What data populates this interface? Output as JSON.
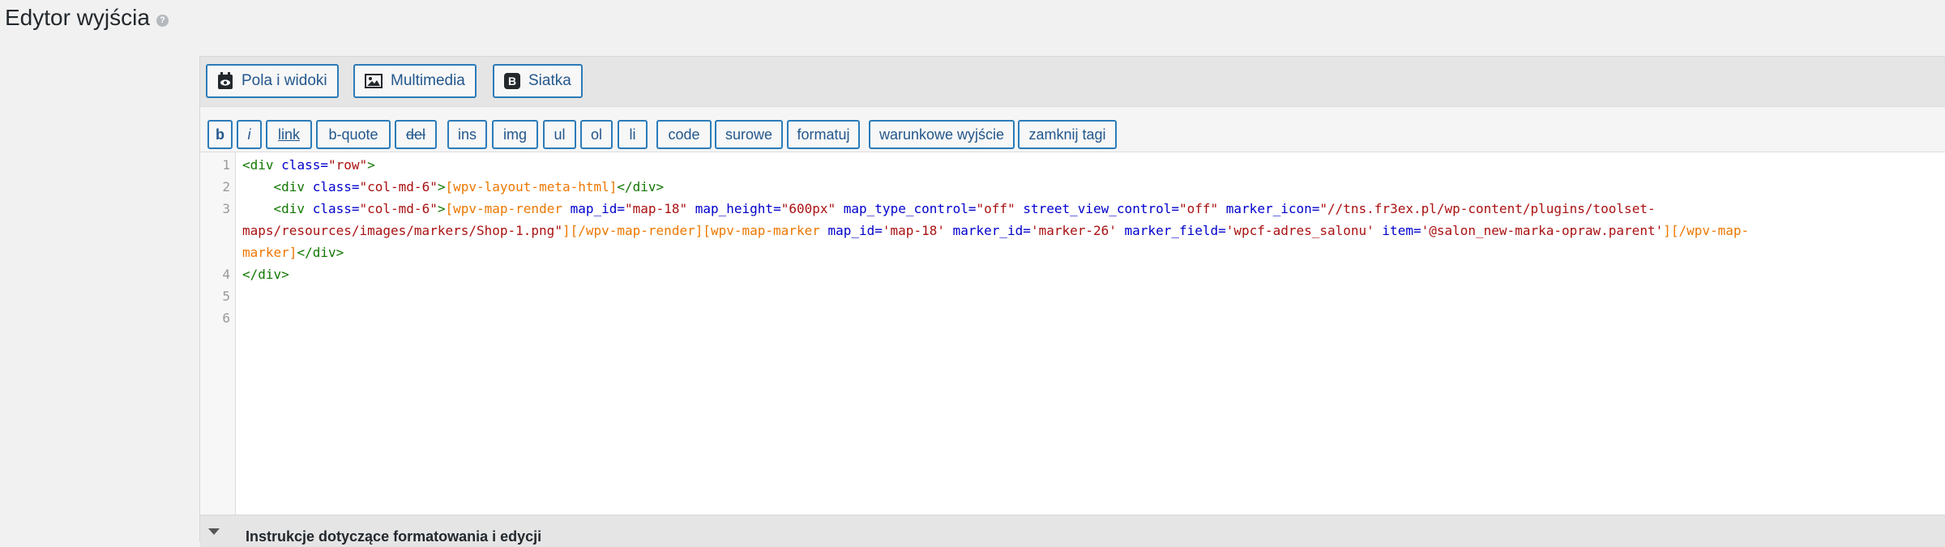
{
  "page": {
    "title": "Edytor wyjścia",
    "help_icon": "question-circle-icon"
  },
  "toolbar": {
    "fields_views_label": "Pola i widoki",
    "multimedia_label": "Multimedia",
    "grid_label": "Siatka"
  },
  "quicktags": [
    {
      "label": "b"
    },
    {
      "label": "i"
    },
    {
      "label": "link"
    },
    {
      "label": "b-quote"
    },
    {
      "label": "del"
    },
    {
      "label": "ins"
    },
    {
      "label": "img"
    },
    {
      "label": "ul"
    },
    {
      "label": "ol"
    },
    {
      "label": "li"
    },
    {
      "label": "code"
    },
    {
      "label": "surowe"
    },
    {
      "label": "formatuj"
    },
    {
      "label": "warunkowe wyjście"
    },
    {
      "label": "zamknij tagi"
    }
  ],
  "editor": {
    "line_numbers": [
      "1",
      "2",
      "3",
      "4",
      "5",
      "6"
    ],
    "l1_tag": "<div ",
    "l1_attr": "class=",
    "l1_str": "\"row\"",
    "l1_end": ">",
    "l2_indent": "    ",
    "l2_tag": "<div ",
    "l2_attr": "class=",
    "l2_str": "\"col-md-6\"",
    "l2_gt": ">",
    "l2_sc": "[wpv-layout-meta-html]",
    "l2_close": "</div>",
    "l3a_indent": "    ",
    "l3a_tag": "<div ",
    "l3a_attr": "class=",
    "l3a_str": "\"col-md-6\"",
    "l3a_gt": ">",
    "l3a_sc": "[wpv-map-render ",
    "l3a_a1": "map_id=",
    "l3a_s1": "\"map-18\" ",
    "l3a_a2": "map_height=",
    "l3a_s2": "\"600px\" ",
    "l3a_a3": "map_type_control=",
    "l3a_s3": "\"off\" ",
    "l3a_a4": "street_view_control=",
    "l3a_s4": "\"off\" ",
    "l3a_a5": "marker_icon=",
    "l3a_s5": "\"//tns.fr3ex.pl/wp-content/plugins/toolset-",
    "l3b_s5": "maps/resources/images/markers/Shop-1.png\"",
    "l3b_sc1": "][/wpv-map-render][wpv-map-marker ",
    "l3b_a1": "map_id=",
    "l3b_s1": "'map-18' ",
    "l3b_a2": "marker_id=",
    "l3b_s2": "'marker-26' ",
    "l3b_a3": "marker_field=",
    "l3b_s3": "'wpcf-adres_salonu' ",
    "l3b_a4": "item=",
    "l3b_s4": "'@salon_new-marka-opraw.parent'",
    "l3b_sc2": "][/wpv-map-",
    "l3c_sc": "marker]",
    "l3c_close": "</div>",
    "l4_close": "</div>"
  },
  "bottom_panel": {
    "label": "Instrukcje dotyczące formatowania i edycji"
  }
}
